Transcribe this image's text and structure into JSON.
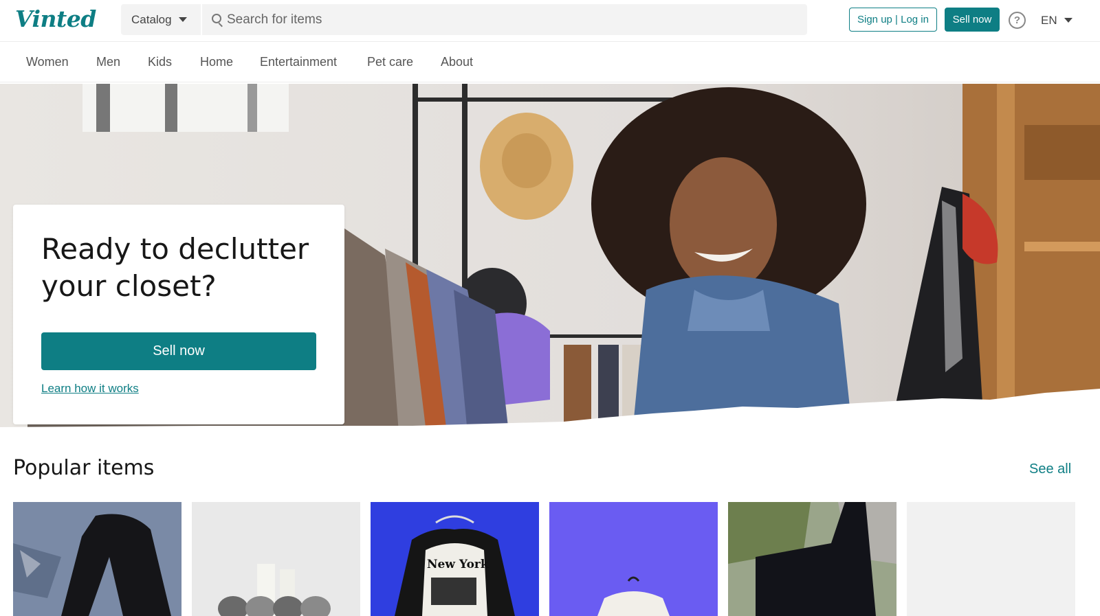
{
  "brand": {
    "logo_text": "Vinted",
    "accent": "#0e7e84"
  },
  "header": {
    "catalog_label": "Catalog",
    "search_placeholder": "Search for items",
    "signup_label": "Sign up | Log in",
    "sell_label": "Sell now",
    "help_icon": "question-circle-icon",
    "language": "EN"
  },
  "nav": {
    "items": [
      "Women",
      "Men",
      "Kids",
      "Home",
      "Entertainment",
      "Pet care",
      "About"
    ]
  },
  "hero": {
    "title": "Ready to declutter your closet?",
    "sell_label": "Sell now",
    "learn_label": "Learn how it works"
  },
  "popular": {
    "title": "Popular items",
    "see_all_label": "See all",
    "items": [
      {
        "kind": "black-pants-photo"
      },
      {
        "kind": "skull-candle-holder-photo"
      },
      {
        "kind": "new-york-tshirt-photo",
        "print_text": "New York"
      },
      {
        "kind": "white-tshirt-purple-bg-photo"
      },
      {
        "kind": "black-bag-photo"
      },
      {
        "kind": "empty-placeholder"
      }
    ]
  }
}
